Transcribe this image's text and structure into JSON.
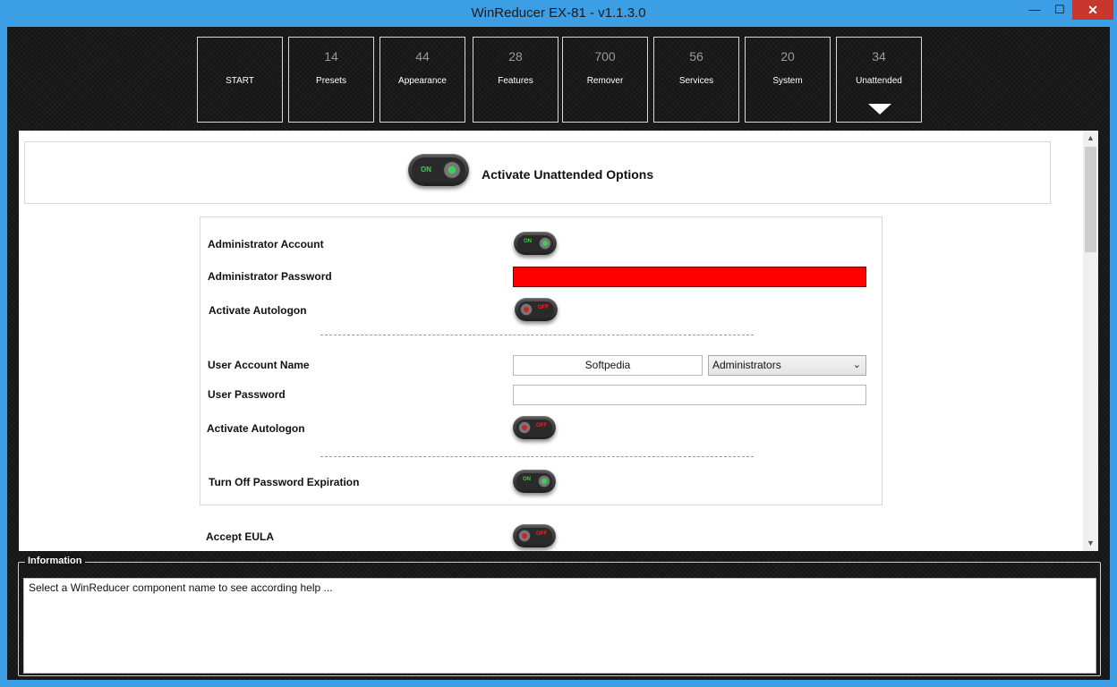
{
  "window": {
    "title": "WinReducer EX-81 - v1.1.3.0",
    "minimize_glyph": "—",
    "maximize_glyph": "☐",
    "close_glyph": "✕"
  },
  "nav": {
    "tiles": [
      {
        "count": "",
        "label": "START"
      },
      {
        "count": "14",
        "label": "Presets"
      },
      {
        "count": "44",
        "label": "Appearance"
      },
      {
        "count": "28",
        "label": "Features"
      },
      {
        "count": "700",
        "label": "Remover"
      },
      {
        "count": "56",
        "label": "Services"
      },
      {
        "count": "20",
        "label": "System"
      },
      {
        "count": "34",
        "label": "Unattended"
      }
    ],
    "selected": "Unattended"
  },
  "unattended": {
    "activate_label": "Activate Unattended Options",
    "activate_state": "ON",
    "admin_account_label": "Administrator Account",
    "admin_account_state": "ON",
    "admin_password_label": "Administrator Password",
    "admin_password_value": "",
    "admin_autologon_label": "Activate Autologon",
    "admin_autologon_state": "OFF",
    "user_account_name_label": "User Account Name",
    "user_account_name_value": "Softpedia",
    "user_group_value": "Administrators",
    "user_password_label": "User Password",
    "user_password_value": "",
    "user_autologon_label": "Activate Autologon",
    "user_autologon_state": "OFF",
    "pw_expiration_label": "Turn Off Password Expiration",
    "pw_expiration_state": "ON",
    "eula_label": "Accept EULA",
    "eula_state": "OFF"
  },
  "scroll": {
    "up_glyph": "▲",
    "down_glyph": "▼"
  },
  "info": {
    "legend": "Information",
    "text": "Select a WinReducer component name to see according help ..."
  },
  "colors": {
    "titlebar": "#3c9ee5",
    "background": "#161616",
    "close_button": "#c7372e",
    "password_error": "#ff0000",
    "toggle_on": "#39d351",
    "toggle_off": "#e12b2b"
  }
}
